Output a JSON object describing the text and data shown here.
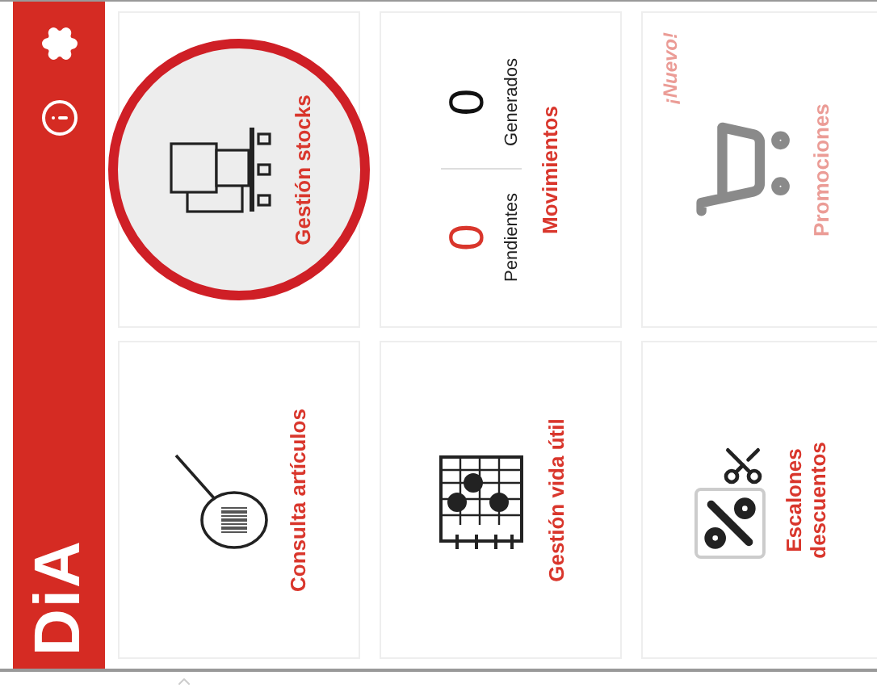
{
  "header": {
    "logo": "DiA"
  },
  "tiles": [
    {
      "kind": "menu",
      "label": "Consulta artículos",
      "selected": false,
      "disabled": false
    },
    {
      "kind": "menu",
      "label": "Gestión stocks",
      "selected": true,
      "disabled": false
    },
    {
      "kind": "menu",
      "label": "Gestión vida útil",
      "selected": false,
      "disabled": false
    },
    {
      "kind": "counters",
      "label": "Movimientos",
      "selected": false,
      "disabled": false,
      "counters": [
        {
          "value": "0",
          "caption": "Pendientes",
          "color": "#d9362c"
        },
        {
          "value": "0",
          "caption": "Generados",
          "color": "#111111"
        }
      ]
    },
    {
      "kind": "menu",
      "label": "Escalones descuentos",
      "selected": false,
      "disabled": false
    },
    {
      "kind": "menu",
      "label": "Promociones",
      "badge": "¡Nuevo!",
      "selected": false,
      "disabled": true
    }
  ]
}
